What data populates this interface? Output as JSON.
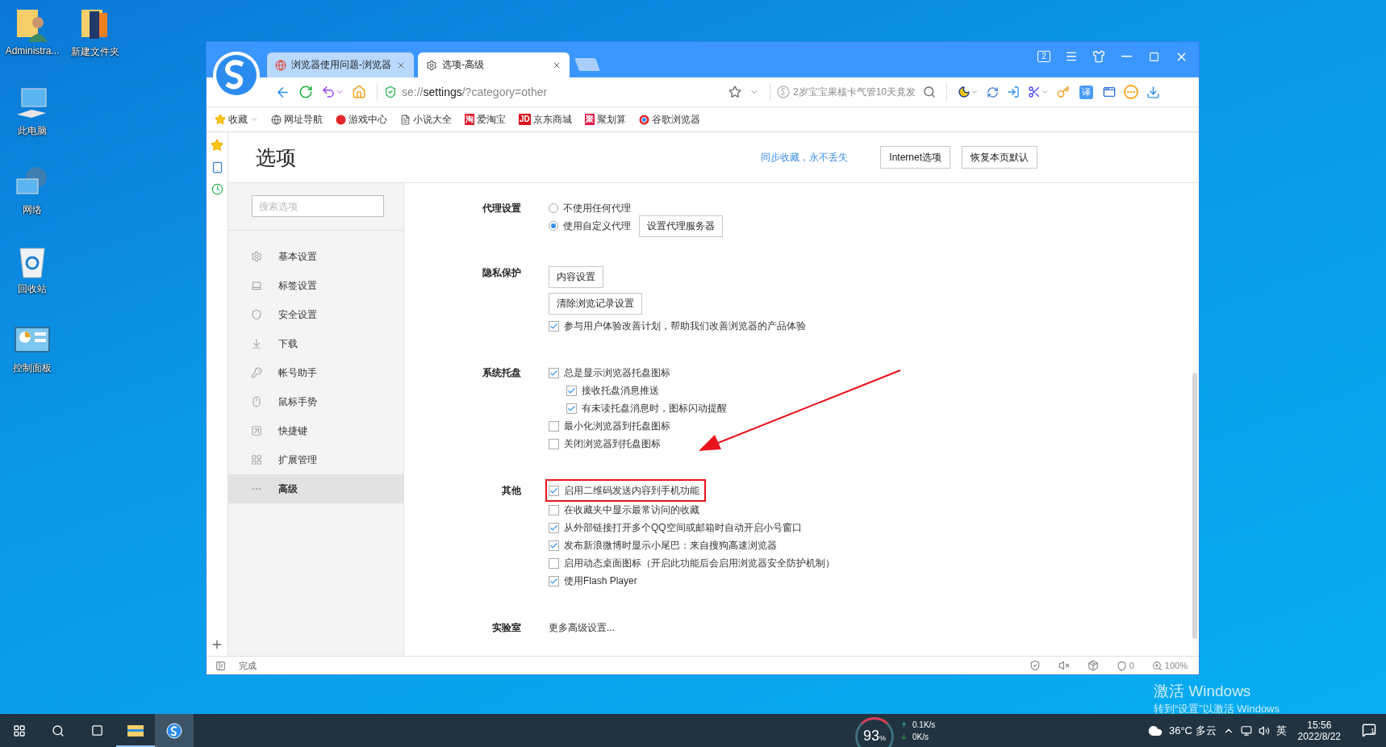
{
  "desktop_icons": [
    {
      "label": "Administra..."
    },
    {
      "label": "新建文件夹"
    },
    {
      "label": "此电脑"
    },
    {
      "label": "网络"
    },
    {
      "label": "回收站"
    },
    {
      "label": "控制面板"
    }
  ],
  "browser": {
    "tabs": [
      {
        "title": "浏览器使用问题-浏览器",
        "selected": false
      },
      {
        "title": "选项-高级",
        "selected": true
      }
    ],
    "window_count": "2",
    "url": [
      "se://",
      "settings",
      "/?category=other"
    ],
    "search_value": "2岁宝宝果核卡气管10天竟发",
    "translate_glyph": "译",
    "bookmarks": [
      {
        "label": "收藏",
        "menu": true
      },
      {
        "label": "网址导航",
        "menu": false
      },
      {
        "label": "游戏中心",
        "menu": false
      },
      {
        "label": "小说大全",
        "menu": false
      },
      {
        "label": "爱淘宝",
        "menu": false,
        "badge": "淘"
      },
      {
        "label": "京东商城",
        "menu": false,
        "badge": "JD"
      },
      {
        "label": "聚划算",
        "menu": false,
        "badge": "聚"
      },
      {
        "label": "谷歌浏览器",
        "menu": false
      }
    ],
    "page": {
      "title": "选项",
      "sync_link": "同步收藏，永不丢失",
      "header_buttons": [
        "Internet选项",
        "恢复本页默认"
      ],
      "search_placeholder": "搜索选项",
      "nav": [
        {
          "label": "基本设置",
          "selected": false
        },
        {
          "label": "标签设置",
          "selected": false
        },
        {
          "label": "安全设置",
          "selected": false
        },
        {
          "label": "下载",
          "selected": false
        },
        {
          "label": "帐号助手",
          "selected": false
        },
        {
          "label": "鼠标手势",
          "selected": false
        },
        {
          "label": "快捷键",
          "selected": false
        },
        {
          "label": "扩展管理",
          "selected": false
        },
        {
          "label": "高级",
          "selected": true
        }
      ],
      "sections": [
        {
          "label": "代理设置",
          "items": [
            {
              "kind": "radio",
              "label": "不使用任何代理",
              "selected": false
            },
            {
              "kind": "radio",
              "label": "使用自定义代理",
              "selected": true,
              "button": "设置代理服务器"
            }
          ]
        },
        {
          "label": "隐私保护",
          "items": [
            {
              "kind": "button",
              "label": "内容设置"
            },
            {
              "kind": "button",
              "label": "清除浏览记录设置"
            },
            {
              "kind": "checkbox",
              "label": "参与用户体验改善计划，帮助我们改善浏览器的产品体验",
              "checked": true
            }
          ]
        },
        {
          "label": "系统托盘",
          "items": [
            {
              "kind": "checkbox",
              "label": "总是显示浏览器托盘图标",
              "checked": true,
              "children": [
                {
                  "kind": "checkbox",
                  "label": "接收托盘消息推送",
                  "checked": true
                },
                {
                  "kind": "checkbox",
                  "label": "有未读托盘消息时，图标闪动提醒",
                  "checked": true
                }
              ]
            },
            {
              "kind": "checkbox",
              "label": "最小化浏览器到托盘图标",
              "checked": false
            },
            {
              "kind": "checkbox",
              "label": "关闭浏览器到托盘图标",
              "checked": false
            }
          ]
        },
        {
          "label": "其他",
          "items": [
            {
              "kind": "checkbox",
              "label": "启用二维码发送内容到手机功能",
              "checked": true,
              "highlighted": true
            },
            {
              "kind": "checkbox",
              "label": "在收藏夹中显示最常访问的收藏",
              "checked": false
            },
            {
              "kind": "checkbox",
              "label": "从外部链接打开多个QQ空间或邮箱时自动开启小号窗口",
              "checked": true
            },
            {
              "kind": "checkbox",
              "label": "发布新浪微博时显示小尾巴：来自搜狗高速浏览器",
              "checked": true
            },
            {
              "kind": "checkbox",
              "label": "启用动态桌面图标（开启此功能后会启用浏览器安全防护机制）",
              "checked": false
            },
            {
              "kind": "checkbox",
              "label": "使用Flash Player",
              "checked": true
            }
          ]
        },
        {
          "label": "实验室",
          "items": [
            {
              "kind": "link",
              "label": "更多高级设置..."
            }
          ]
        }
      ]
    },
    "status": {
      "text": "完成",
      "adblock_count": "0",
      "zoom": "100%"
    }
  },
  "activation": [
    "激活 Windows",
    "转到“设置”以激活 Windows"
  ],
  "taskbar": {
    "cpu": "93",
    "cpu_unit": "%",
    "upload": "0.1K/s",
    "download": "0K/s",
    "weather": "36°C 多云",
    "ime": "英",
    "time": "15:56",
    "date": "2022/8/22",
    "notifications": "1"
  }
}
